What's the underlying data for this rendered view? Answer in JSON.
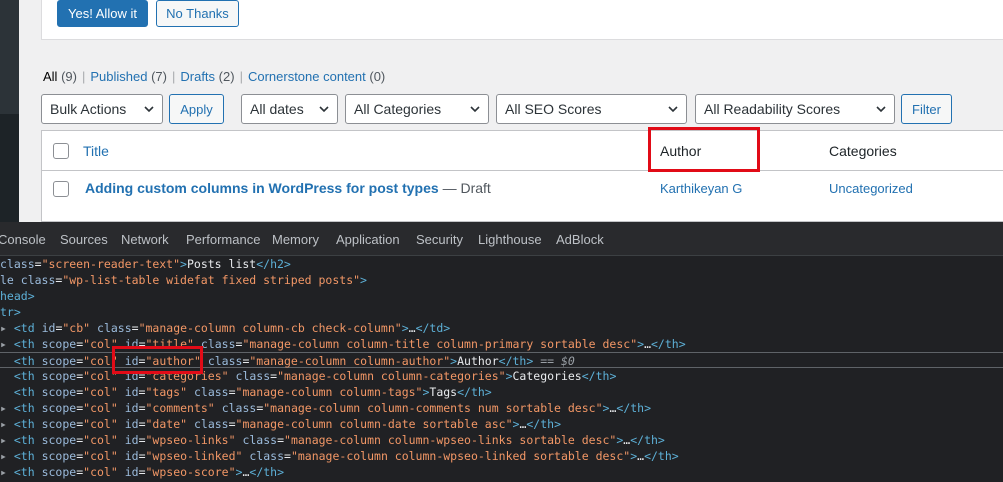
{
  "notice": {
    "allow_label": "Yes! Allow it",
    "no_label": "No Thanks"
  },
  "subsub": [
    {
      "label": "All",
      "count": "(9)"
    },
    {
      "label": "Published",
      "count": "(7)"
    },
    {
      "label": "Drafts",
      "count": "(2)"
    },
    {
      "label": "Cornerstone content",
      "count": "(0)"
    }
  ],
  "filters": {
    "bulk_actions": "Bulk Actions",
    "apply_label": "Apply",
    "dates": "All dates",
    "categories": "All Categories",
    "seo": "All SEO Scores",
    "readability": "All Readability Scores",
    "filter_label": "Filter"
  },
  "table": {
    "headers": {
      "title": "Title",
      "author": "Author",
      "categories": "Categories"
    },
    "rows": [
      {
        "title": "Adding custom columns in WordPress for post types",
        "state": "— Draft",
        "author": "Karthikeyan G",
        "categories": "Uncategorized"
      }
    ]
  },
  "devtools": {
    "tabs": [
      "Console",
      "Sources",
      "Network",
      "Performance",
      "Memory",
      "Application",
      "Security",
      "Lighthouse",
      "AdBlock"
    ]
  },
  "colors": {
    "accent": "#2271b1",
    "highlight": "#e10b17",
    "devtools_bg": "#202124"
  }
}
